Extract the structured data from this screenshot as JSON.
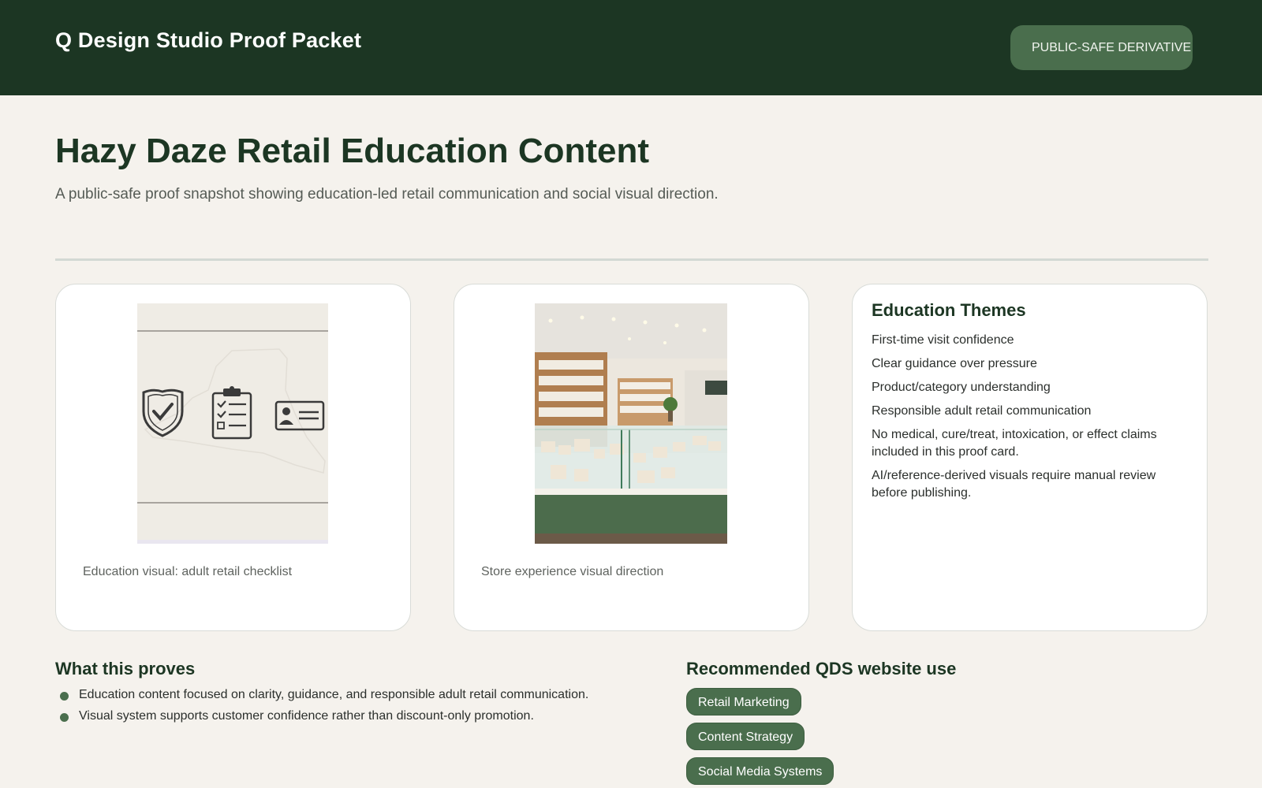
{
  "header": {
    "brand": "Q Design Studio Proof Packet",
    "badge": "PUBLIC-SAFE DERIVATIVE"
  },
  "page": {
    "title": "Hazy Daze Retail Education Content",
    "subtitle": "A public-safe proof snapshot showing education-led retail communication and social visual direction."
  },
  "cards": [
    {
      "caption": "Education visual: adult retail checklist",
      "icons": [
        "shield-check-icon",
        "clipboard-checklist-icon",
        "id-card-icon"
      ]
    },
    {
      "caption": "Store experience visual direction"
    }
  ],
  "themes": {
    "title": "Education Themes",
    "items": [
      "First-time visit confidence",
      "Clear guidance over pressure",
      "Product/category understanding",
      "Responsible adult retail communication",
      "No medical, cure/treat, intoxication, or effect claims included in this proof card.",
      "AI/reference-derived visuals require manual review before publishing."
    ]
  },
  "proves": {
    "title": "What this proves",
    "items": [
      "Education content focused on clarity, guidance, and responsible adult retail communication.",
      "Visual system supports customer confidence rather than discount-only promotion."
    ]
  },
  "website_use": {
    "title": "Recommended QDS website use",
    "tags": [
      "Retail Marketing",
      "Content Strategy",
      "Social Media Systems"
    ]
  },
  "colors": {
    "header_bg": "#1c3623",
    "accent": "#4a6e4d",
    "page_bg": "#f5f2ed"
  }
}
